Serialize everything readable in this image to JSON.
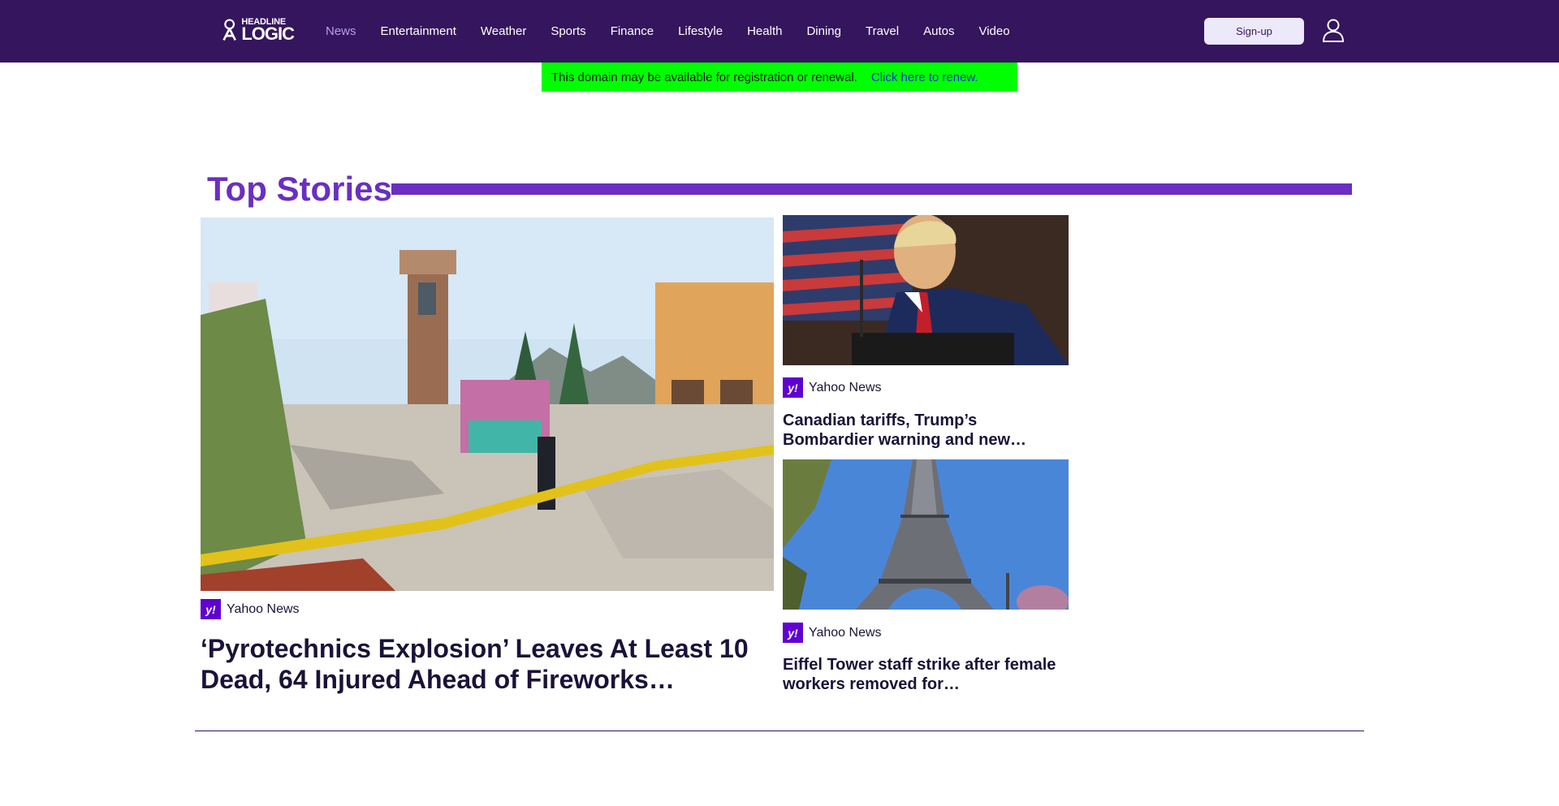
{
  "header": {
    "logo": {
      "top": "HEADLINE",
      "bottom": "LOGIC"
    },
    "nav_items": [
      {
        "label": "News",
        "active": true
      },
      {
        "label": "Entertainment"
      },
      {
        "label": "Weather"
      },
      {
        "label": "Sports"
      },
      {
        "label": "Finance"
      },
      {
        "label": "Lifestyle"
      },
      {
        "label": "Health"
      },
      {
        "label": "Dining"
      },
      {
        "label": "Travel"
      },
      {
        "label": "Autos"
      },
      {
        "label": "Video"
      }
    ],
    "signup_label": "Sign-up",
    "user_icon": "user-icon"
  },
  "renewal_banner": {
    "text": "This domain may be available for registration or renewal.",
    "link": "Click here to renew."
  },
  "top_stories": {
    "title": "Top Stories",
    "main": {
      "source": "Yahoo News",
      "headline": "‘Pyrotechnics Explosion’ Leaves At Least 10 Dead, 64 Injured Ahead of Fireworks…"
    },
    "side": [
      {
        "source": "Yahoo News",
        "headline": "Canadian tariffs, Trump’s Bombardier warning and new…"
      },
      {
        "source": "Yahoo News",
        "headline": "Eiffel Tower staff strike after female workers removed for…"
      }
    ]
  },
  "colors": {
    "nav_bg": "#35155d",
    "accent": "#6a2fc0",
    "banner_bg": "#00ff00",
    "yahoo_purple": "#6001d2"
  }
}
